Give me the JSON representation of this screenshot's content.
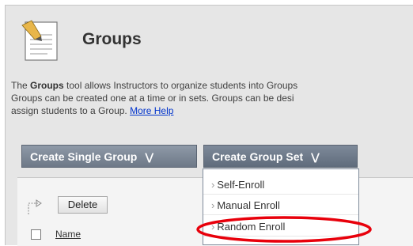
{
  "page": {
    "title": "Groups",
    "icon": "notepad-icon"
  },
  "description": {
    "line1_prefix": "The ",
    "line1_bold": "Groups",
    "line1_rest": " tool allows Instructors to organize students into Groups",
    "line2": "Groups can be created one at a time or in sets. Groups can be desi",
    "line3": "assign students to a Group. ",
    "help_link": "More Help"
  },
  "action_bar": {
    "create_single_group": "Create Single Group",
    "create_group_set": "Create Group Set",
    "chevron_icon": "double-chevron-down-icon"
  },
  "dropdown": {
    "items": [
      {
        "label": "Self-Enroll"
      },
      {
        "label": "Manual Enroll"
      },
      {
        "label": "Random Enroll"
      }
    ],
    "highlighted_item": "Random Enroll",
    "highlight_color": "#e8000b"
  },
  "list": {
    "delete_label": "Delete",
    "name_column": "Name"
  }
}
